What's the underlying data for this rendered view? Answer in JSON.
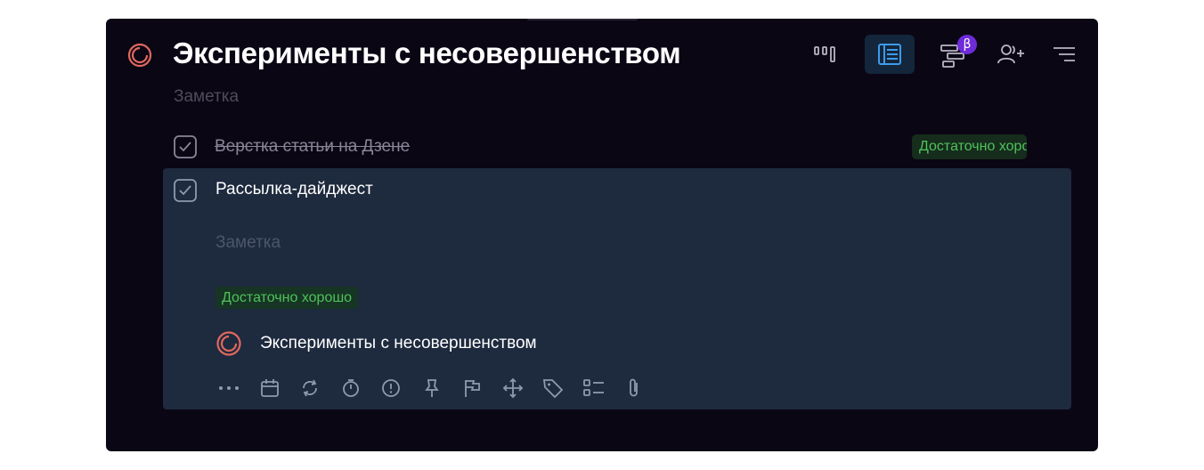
{
  "colors": {
    "window_bg": "#0b0614",
    "expanded_bg": "#1e2a3e",
    "accent_red": "#e0685e",
    "accent_blue": "#3d9be9",
    "tag_green": "#4fc25b",
    "beta_purple": "#6d2bd9"
  },
  "header": {
    "title": "Эксперименты с несовершенством",
    "note_placeholder": "Заметка",
    "beta_badge": "β",
    "toolbar": [
      {
        "icon": "board-view-icon"
      },
      {
        "icon": "list-view-icon",
        "active": true
      },
      {
        "icon": "timeline-view-icon"
      },
      {
        "icon": "add-user-icon"
      },
      {
        "icon": "sort-menu-icon"
      }
    ]
  },
  "tasks": [
    {
      "title": "Верстка статьи на Дзене",
      "completed": true,
      "tag": "Достаточно хорошо",
      "tag_remove": "x"
    },
    {
      "title": "Рассылка-дайджест",
      "completed": true,
      "note_placeholder": "Заметка",
      "tag": "Достаточно хорошо",
      "project": "Эксперименты с несовершенством"
    }
  ],
  "actions": [
    "more-icon",
    "calendar-icon",
    "repeat-icon",
    "timer-icon",
    "priority-icon",
    "pin-icon",
    "flag-icon",
    "move-icon",
    "tag-icon",
    "checklist-icon",
    "attachment-icon"
  ]
}
